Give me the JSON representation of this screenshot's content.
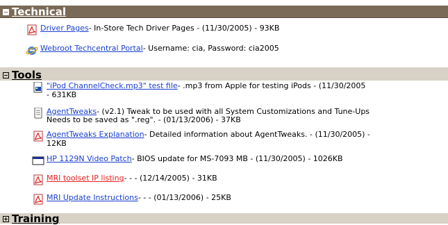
{
  "sections": {
    "technical": {
      "title": "Technical",
      "items": [
        {
          "icon": "pdf-icon",
          "link": "Driver Pages",
          "desc": " - In-Store Tech Driver Pages - (11/30/2005) - 93KB"
        },
        {
          "icon": "ie-web-icon",
          "link": "Webroot Techcentral Portal",
          "desc": " - Username: cia, Password: cia2005"
        }
      ]
    },
    "tools": {
      "title": "Tools",
      "items": [
        {
          "icon": "media-file-icon",
          "link": "\"iPod ChannelCheck.mp3\" test file",
          "desc": " - .mp3 from Apple for testing iPods - (11/30/2005",
          "desc2": "- 631KB"
        },
        {
          "icon": "text-file-icon",
          "link": "AgentTweaks",
          "desc": " - (v2.1) Tweak to be used with all System Customizations and Tune-Ups",
          "desc2": "Needs to be saved as \".reg\". - (01/13/2006) - 37KB"
        },
        {
          "icon": "pdf-icon",
          "link": "AgentTweaks Explanation",
          "desc": " - Detailed information about AgentTweaks. - (11/30/2005) -",
          "desc2": "12KB"
        },
        {
          "icon": "window-icon",
          "link": "HP 1129N Video Patch",
          "desc": " - BIOS update for MS-7093 MB - (11/30/2005) - 1026KB"
        },
        {
          "icon": "pdf-icon",
          "link": "MRI toolset IP listing",
          "desc": " - - - (12/14/2005) - 31KB",
          "visited": true
        },
        {
          "icon": "pdf-icon",
          "link": "MRI Update Instructions",
          "desc": " - - - (01/13/2006) - 25KB"
        }
      ]
    },
    "training": {
      "title": "Training"
    }
  }
}
